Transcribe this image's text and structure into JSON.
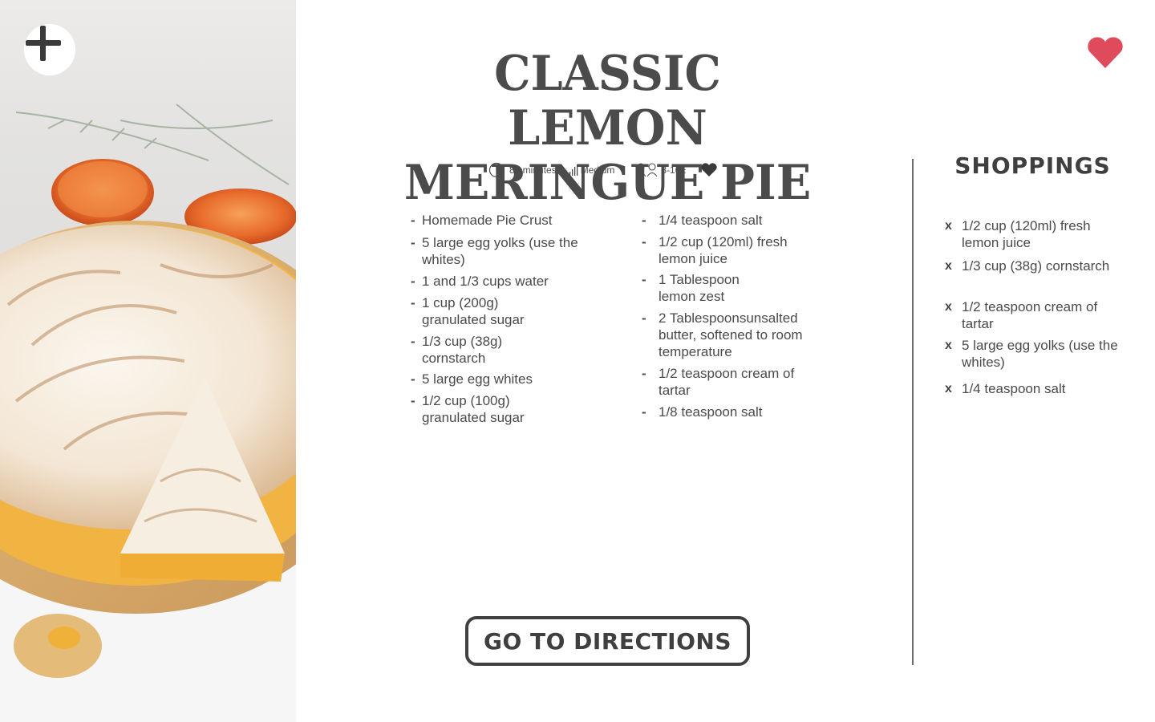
{
  "recipe": {
    "title_line1": "CLASSIC LEMON",
    "title_line2": "MERINGUE PIE",
    "time": "80 minutes",
    "difficulty": "Medium",
    "servings": "8-10±"
  },
  "ingredients": {
    "col1": [
      {
        "bullet": "-",
        "text": "Homemade Pie Crust"
      },
      {
        "bullet": "-",
        "text": "5 large egg yolks (use the whites)"
      },
      {
        "bullet": "-",
        "text": "1 and 1/3 cups  water"
      },
      {
        "bullet": "-",
        "text": "1 cup (200g) granulated sugar"
      },
      {
        "bullet": "-",
        "text": "1/3 cup (38g) cornstarch"
      },
      {
        "bullet": "-",
        "text": "5 large egg whites"
      },
      {
        "bullet": "-",
        "text": "1/2 cup (100g) granulated sugar"
      }
    ],
    "col2": [
      {
        "bullet": "-",
        "text": "1/4 teaspoon salt"
      },
      {
        "bullet": "-",
        "text": "1/2 cup (120ml) fresh lemon juice"
      },
      {
        "bullet": "-",
        "text": "1 Tablespoon lemon zest"
      },
      {
        "bullet": "-",
        "text": "2 Tablespoonsunsalted butter, softened to room temperature"
      },
      {
        "bullet": "-",
        "text": "1/2 teaspoon cream of tartar"
      },
      {
        "bullet": "-",
        "text": "1/8 teaspoon salt"
      }
    ]
  },
  "shopping": {
    "title": "SHOPPINGS",
    "remove_symbol": "x",
    "items": [
      "1/2 cup (120ml) fresh lemon juice",
      "1/3 cup (38g) cornstarch",
      "1/2 teaspoon cream of tartar",
      "5 large egg yolks (use the whites)",
      "1/4 teaspoon salt"
    ]
  },
  "directions_button": "GO TO DIRECTIONS",
  "icons": {
    "add": "plus-icon",
    "favorite": "heart-icon",
    "time": "clock-icon",
    "difficulty": "signal-bars-icon",
    "servings": "people-icon",
    "like": "heart-icon"
  },
  "colors": {
    "favorite": "#e04a5d",
    "text": "#4a4a4a",
    "heading": "#3f3f3f",
    "button_border": "#404040"
  }
}
